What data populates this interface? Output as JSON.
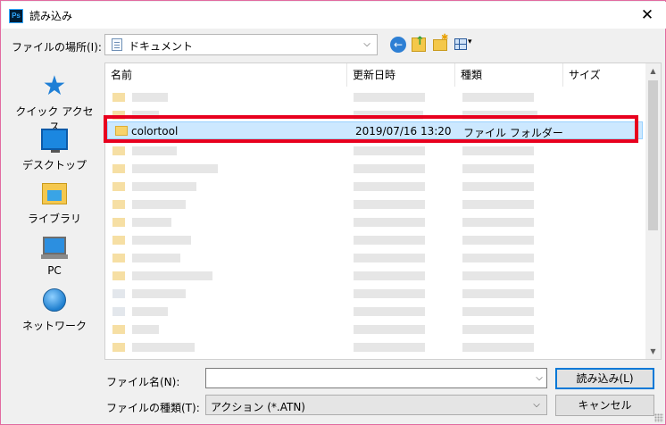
{
  "window": {
    "app_icon_text": "Ps",
    "title": "読み込み",
    "close_glyph": "✕"
  },
  "location": {
    "label": "ファイルの場所(I):",
    "value": "ドキュメント",
    "dropdown_glyph": "⌵",
    "back_glyph": "←",
    "view_menu_glyph": "▾"
  },
  "places": [
    {
      "label": "クイック アクセス",
      "icon": "star-icon"
    },
    {
      "label": "デスクトップ",
      "icon": "desktop-icon"
    },
    {
      "label": "ライブラリ",
      "icon": "library-icon"
    },
    {
      "label": "PC",
      "icon": "pc-icon"
    },
    {
      "label": "ネットワーク",
      "icon": "network-icon"
    }
  ],
  "filelist": {
    "sort_glyph": "^",
    "columns": [
      "名前",
      "更新日時",
      "種類",
      "サイズ"
    ],
    "selected_row": {
      "name": "colortool",
      "modified": "2019/07/16 13:20",
      "type": "ファイル フォルダー",
      "size": ""
    },
    "scroll_up_glyph": "▲",
    "scroll_down_glyph": "▼"
  },
  "filename": {
    "label": "ファイル名(N):",
    "value": "",
    "dropdown_glyph": "⌵"
  },
  "filetype": {
    "label": "ファイルの種類(T):",
    "value": "アクション (*.ATN)",
    "dropdown_glyph": "⌵"
  },
  "buttons": {
    "open": "読み込み(L)",
    "cancel": "キャンセル"
  },
  "colors": {
    "highlight_border": "#e8001e",
    "selection_bg": "#cce8ff",
    "accent": "#0078d7"
  }
}
